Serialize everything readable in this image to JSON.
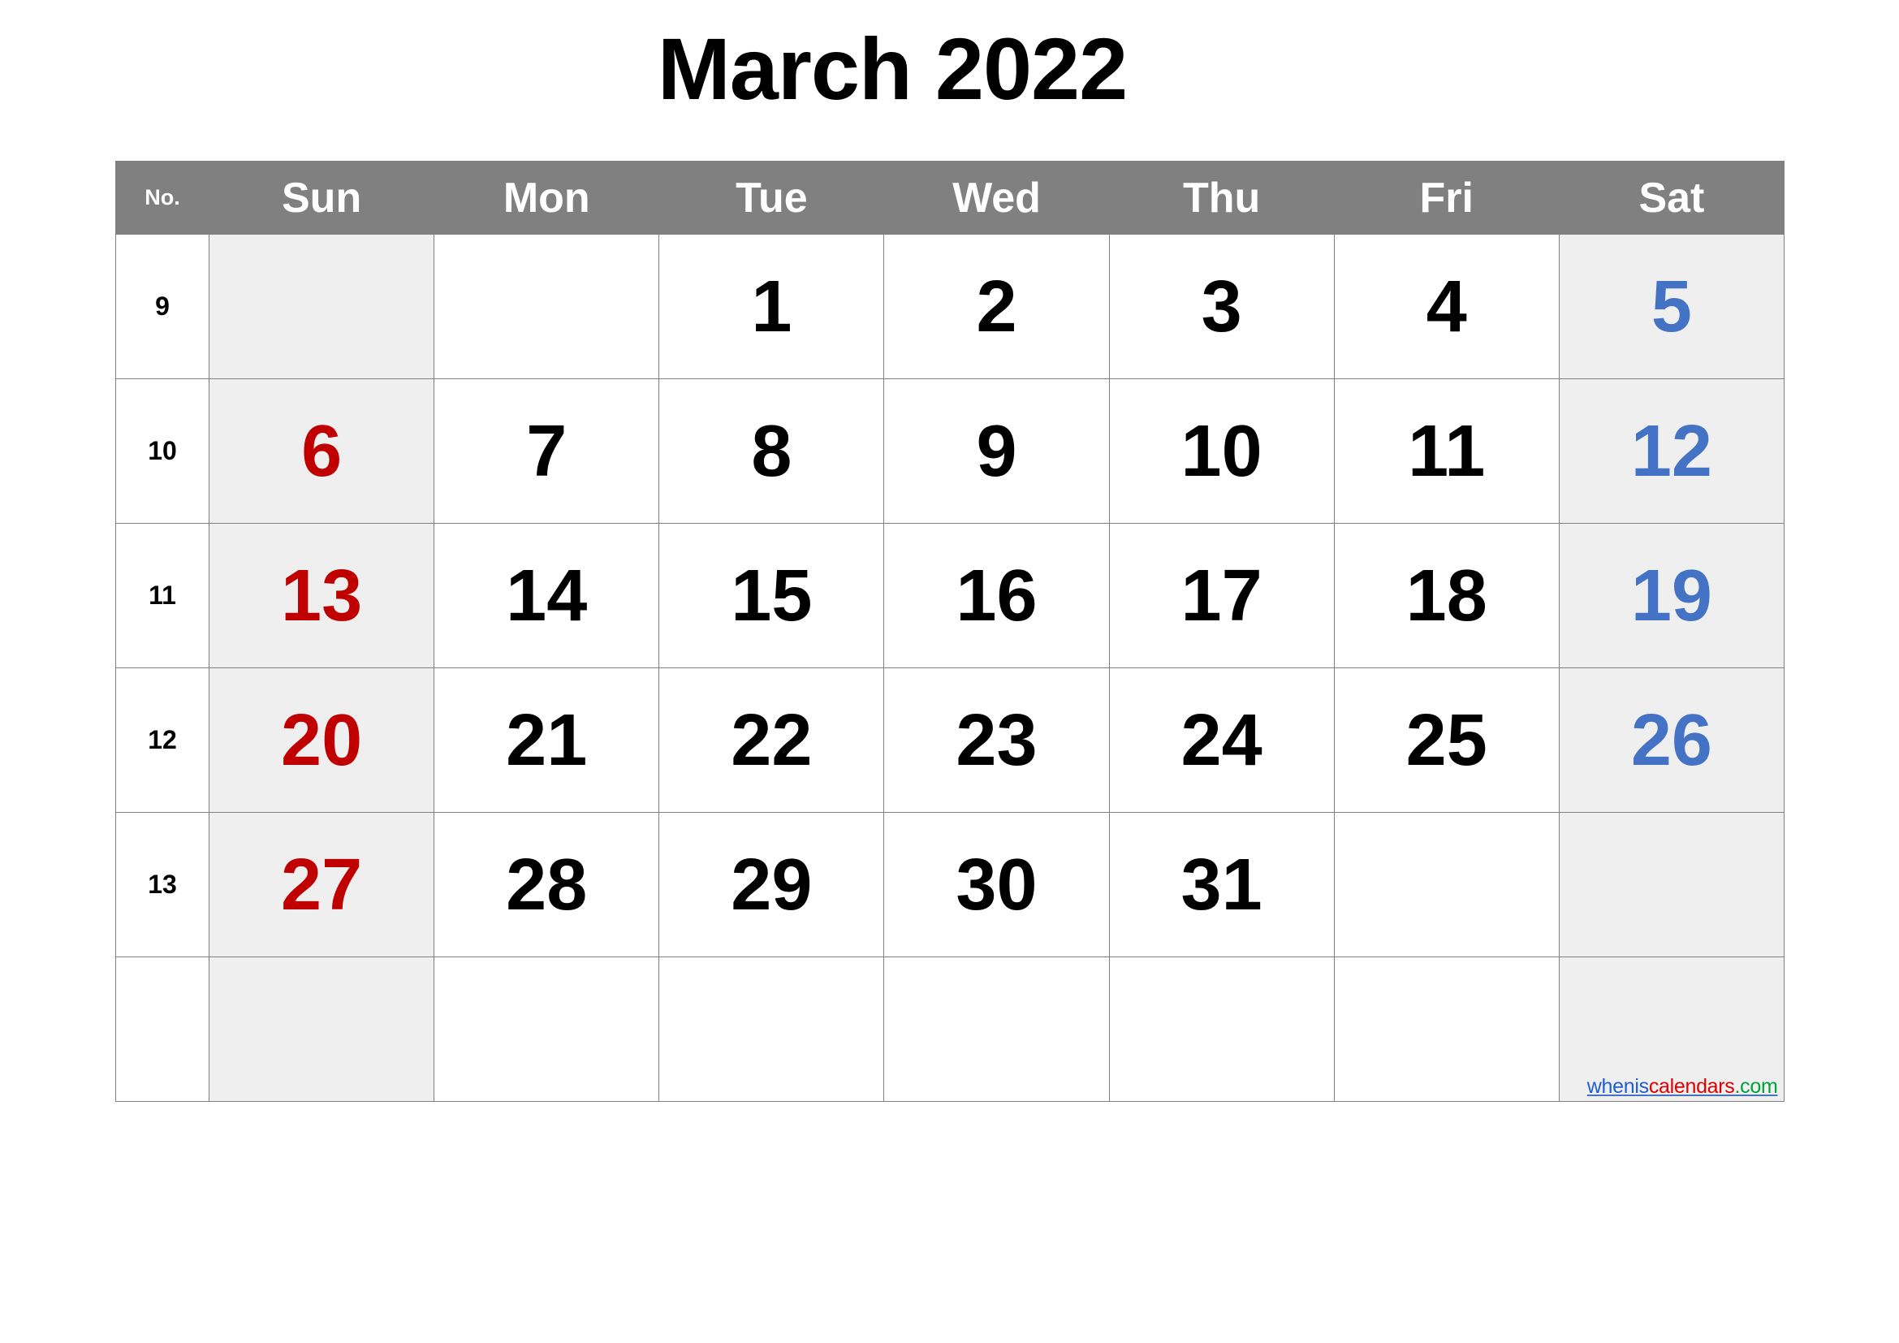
{
  "title": "March 2022",
  "colors": {
    "header_bg": "#808080",
    "header_text": "#ffffff",
    "weekend_bg": "#efefef",
    "sunday_text": "#c00000",
    "saturday_text": "#4472c4",
    "weekday_text": "#000000",
    "grid_line": "#808080"
  },
  "table": {
    "week_col_header": "No.",
    "day_headers": [
      "Sun",
      "Mon",
      "Tue",
      "Wed",
      "Thu",
      "Fri",
      "Sat"
    ],
    "rows": [
      {
        "week": "9",
        "days": [
          "",
          "",
          "1",
          "2",
          "3",
          "4",
          "5"
        ]
      },
      {
        "week": "10",
        "days": [
          "6",
          "7",
          "8",
          "9",
          "10",
          "11",
          "12"
        ]
      },
      {
        "week": "11",
        "days": [
          "13",
          "14",
          "15",
          "16",
          "17",
          "18",
          "19"
        ]
      },
      {
        "week": "12",
        "days": [
          "20",
          "21",
          "22",
          "23",
          "24",
          "25",
          "26"
        ]
      },
      {
        "week": "13",
        "days": [
          "27",
          "28",
          "29",
          "30",
          "31",
          "",
          ""
        ]
      },
      {
        "week": "",
        "days": [
          "",
          "",
          "",
          "",
          "",
          "",
          ""
        ]
      }
    ]
  },
  "watermark": {
    "part1": "whenis",
    "part2": "calendars",
    "part3": ".com"
  }
}
